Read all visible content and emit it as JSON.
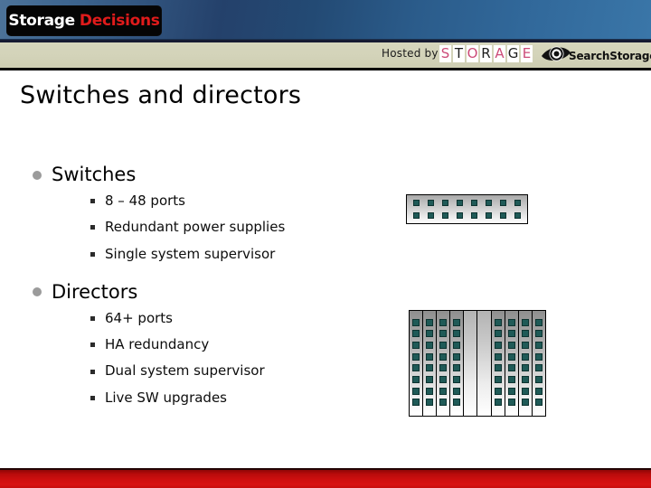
{
  "header": {
    "brand": {
      "word1": "Storage",
      "word2": "Decisions",
      "word1_color": "#ffffff",
      "word2_color": "#e01b1b",
      "plate_color": "#050505"
    },
    "band_color": "#24416b",
    "strip_color": "#d3d3b9",
    "hosted_by_label": "Hosted by",
    "storage_wordmark": {
      "letters": [
        "S",
        "T",
        "O",
        "R",
        "A",
        "G",
        "E"
      ],
      "letter_styles": [
        "pink",
        "dark",
        "pink",
        "dark",
        "pink",
        "dark",
        "pink"
      ],
      "pink": "#cc4b78",
      "dark": "#1d1d1d"
    },
    "searchstorage": {
      "icon": "eye-icon",
      "text": "SearchStorage.com"
    }
  },
  "slide": {
    "title": "Switches and directors",
    "groups": [
      {
        "bullet_icon": "filled-circle-bullet",
        "label": "Switches",
        "sub_items": [
          {
            "bullet_icon": "square-bullet",
            "label": "8 – 48 ports"
          },
          {
            "bullet_icon": "square-bullet",
            "label": "Redundant power supplies"
          },
          {
            "bullet_icon": "square-bullet",
            "label": "Single system supervisor"
          }
        ]
      },
      {
        "bullet_icon": "filled-circle-bullet",
        "label": "Directors",
        "sub_items": [
          {
            "bullet_icon": "square-bullet",
            "label": "64+ ports"
          },
          {
            "bullet_icon": "square-bullet",
            "label": "HA redundancy"
          },
          {
            "bullet_icon": "square-bullet",
            "label": "Dual system supervisor"
          },
          {
            "bullet_icon": "square-bullet",
            "label": "Live SW upgrades"
          }
        ]
      }
    ]
  },
  "graphics": {
    "switch": {
      "name": "switch-chassis-illustration",
      "port_rows": 2,
      "ports_per_row": 8,
      "port_color": "#1f5a57"
    },
    "director": {
      "name": "director-chassis-illustration",
      "blade_count": 10,
      "blank_blade_indexes": [
        4,
        5
      ],
      "ports_per_blade": 8,
      "port_color": "#1f5a57"
    }
  },
  "footer": {
    "band_color": "#cf0f0f"
  }
}
